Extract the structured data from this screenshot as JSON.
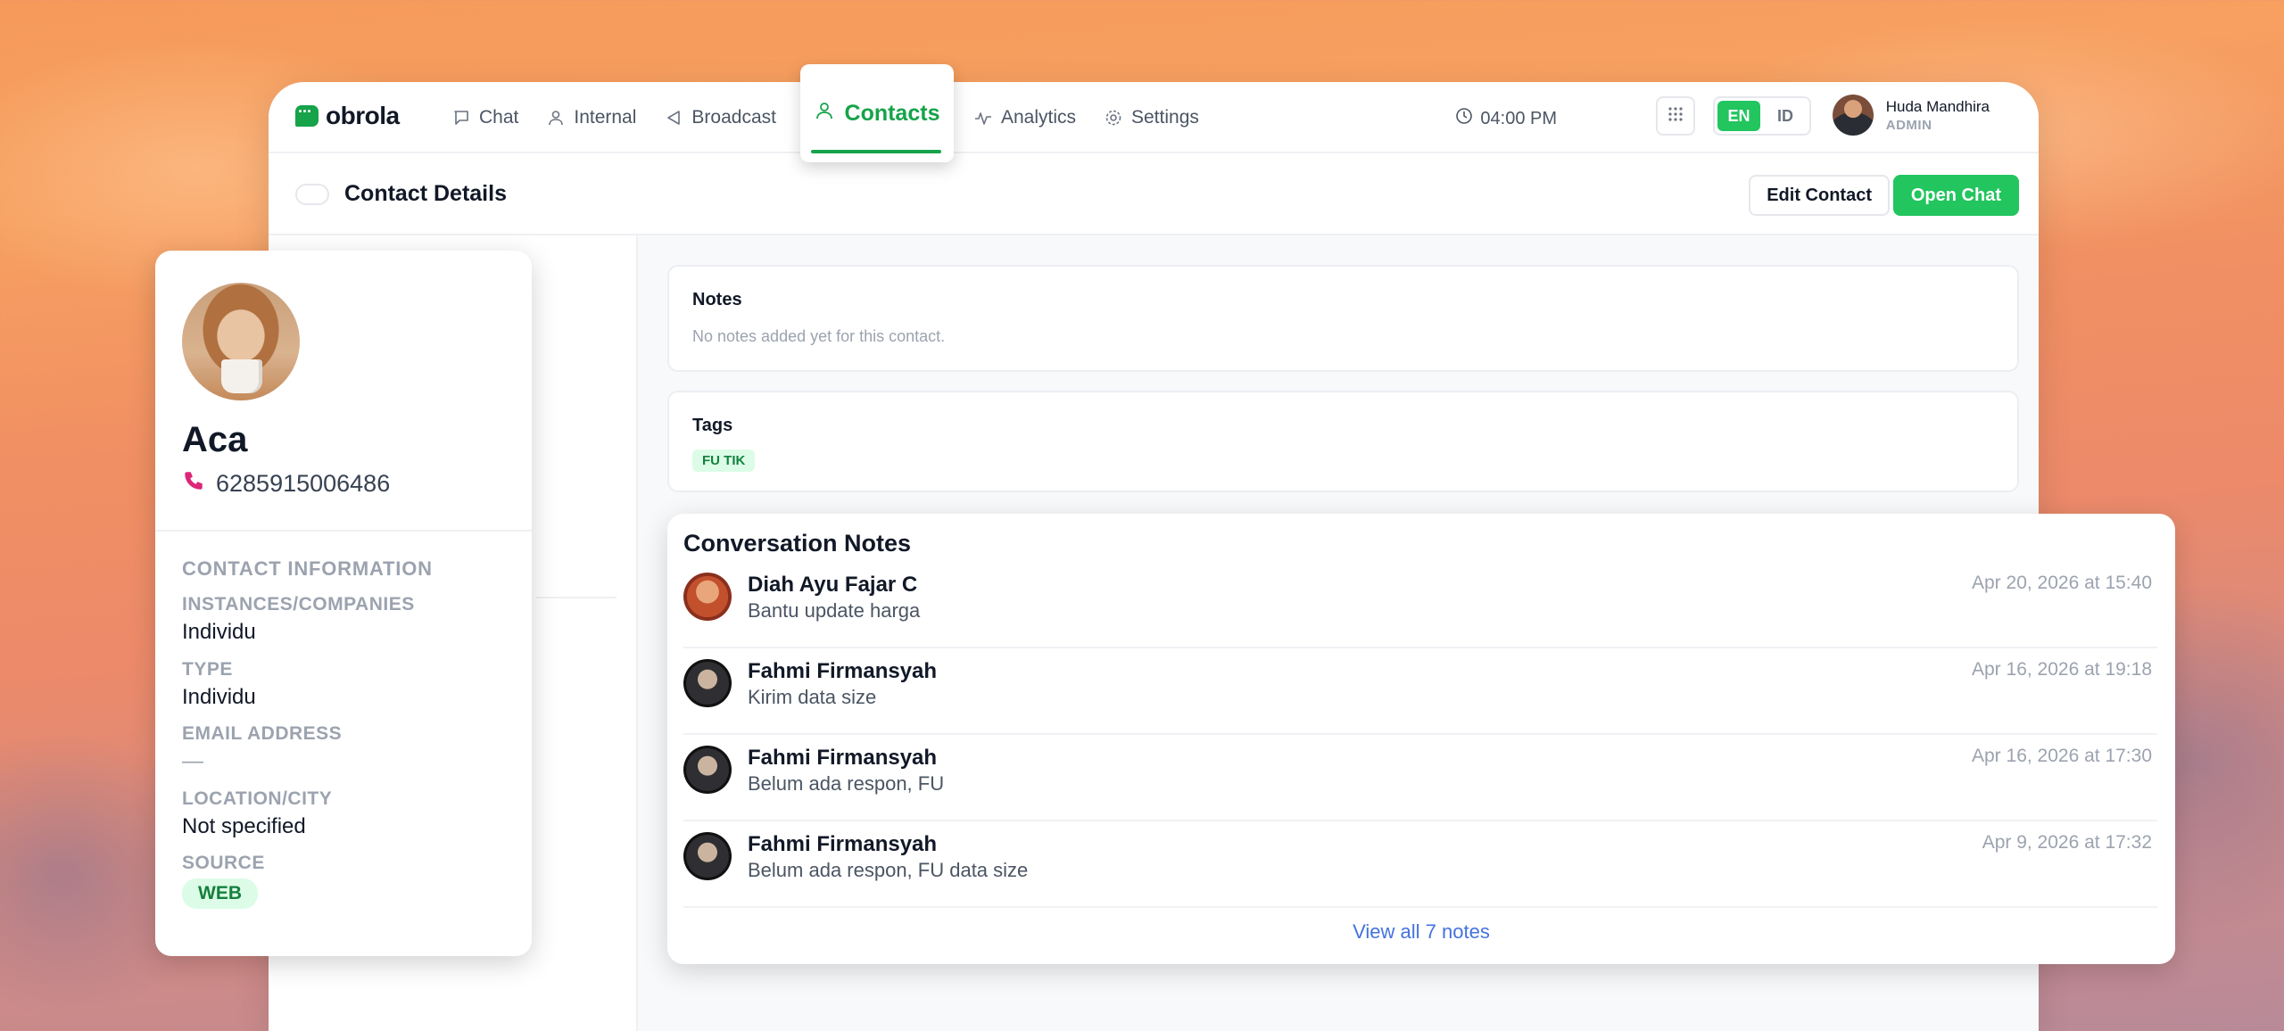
{
  "app": {
    "logo": "obrola",
    "nav": [
      {
        "label": "Chat",
        "icon": "chat-bubble-icon"
      },
      {
        "label": "Internal",
        "icon": "user-icon"
      },
      {
        "label": "Broadcast",
        "icon": "megaphone-icon"
      },
      {
        "label": "Contacts",
        "icon": "person-icon",
        "active": true
      },
      {
        "label": "Analytics",
        "icon": "activity-icon"
      },
      {
        "label": "Settings",
        "icon": "gear-icon"
      }
    ],
    "time": "04:00 PM",
    "languages": [
      "EN",
      "ID"
    ],
    "active_language": "EN",
    "user": {
      "name": "Huda Mandhira",
      "role": "ADMIN"
    },
    "accent": "#22c55e"
  },
  "page": {
    "title": "Contact Details",
    "edit_label": "Edit Contact",
    "open_chat_label": "Open Chat"
  },
  "notes": {
    "title": "Notes",
    "empty": "No notes added yet for this contact."
  },
  "tags": {
    "title": "Tags",
    "items": [
      "FU TIK"
    ]
  },
  "contact": {
    "name": "Aca",
    "phone": "6285915006486",
    "section_title": "CONTACT INFORMATION",
    "fields": [
      {
        "label": "INSTANCES/COMPANIES",
        "value": "Individu"
      },
      {
        "label": "TYPE",
        "value": "Individu"
      },
      {
        "label": "EMAIL ADDRESS",
        "value": "—"
      },
      {
        "label": "LOCATION/CITY",
        "value": "Not specified"
      }
    ],
    "source_label": "SOURCE",
    "source_value": "WEB"
  },
  "conversation_notes": {
    "title": "Conversation Notes",
    "items": [
      {
        "author": "Diah Ayu Fajar C",
        "text": "Bantu update harga",
        "time": "Apr 20, 2026 at 15:40"
      },
      {
        "author": "Fahmi Firmansyah",
        "text": "Kirim data size",
        "time": "Apr 16, 2026 at 19:18"
      },
      {
        "author": "Fahmi Firmansyah",
        "text": "Belum ada respon, FU",
        "time": "Apr 16, 2026 at 17:30"
      },
      {
        "author": "Fahmi Firmansyah",
        "text": "Belum ada respon, FU data size",
        "time": "Apr 9, 2026 at 17:32"
      }
    ],
    "view_all": "View all 7 notes"
  }
}
